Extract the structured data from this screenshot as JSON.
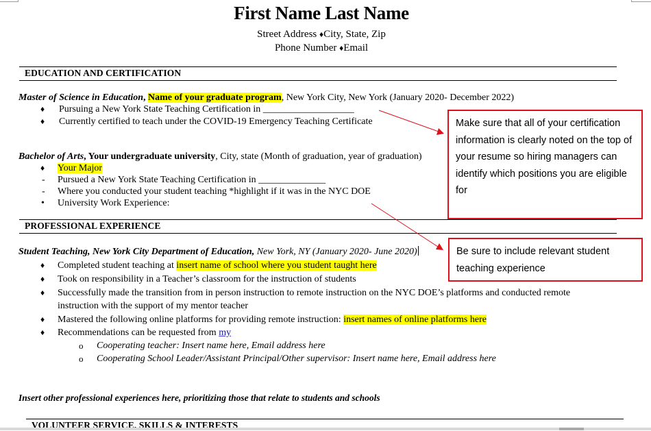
{
  "header": {
    "name": "First Name Last Name",
    "contact_line1": {
      "street": "Street Address ",
      "separator": "♦",
      "city": "City, State, Zip"
    },
    "contact_line2": {
      "phone": "Phone Number ",
      "separator": "♦",
      "email": "Email"
    }
  },
  "sections": {
    "education": {
      "title": "EDUCATION AND CERTIFICATION",
      "masters": {
        "degree": "Master of Science in Education",
        "comma": ", ",
        "program": "Name of your graduate program",
        "rest": ", New York City, New York (January 2020- December 2022)",
        "bullets": [
          {
            "marker": "♦",
            "text": "Pursuing a New York State Teaching Certification in ___________________"
          },
          {
            "marker": "♦",
            "text": "Currently certified to teach under the COVID-19 Emergency Teaching Certificate"
          }
        ]
      },
      "bachelors": {
        "degree": "Bachelor of Arts",
        "comma": ", ",
        "university": "Your undergraduate university",
        "rest": ", City, state (Month of graduation, year of graduation)",
        "bullets": [
          {
            "marker": "♦",
            "text": "Your Major",
            "highlight": true
          },
          {
            "marker": "-",
            "text": "Pursued a New York State Teaching Certification in ______________"
          },
          {
            "marker": "-",
            "text": "Where you conducted your student teaching *highlight if it was in the NYC DOE"
          },
          {
            "marker": "•",
            "text": "University Work Experience:"
          }
        ]
      }
    },
    "experience": {
      "title": "PROFESSIONAL EXPERIENCE",
      "student_teaching": {
        "role": "Student Teaching, New York City Department of Education,",
        "location_dates": " New York, NY (January 2020- June 2020)",
        "bullets": [
          {
            "marker": "♦",
            "prefix": "Completed student teaching at ",
            "highlight": "insert name of school where you student taught here"
          },
          {
            "marker": "♦",
            "prefix": "Took on responsibility in a Teacher’s classroom for the instruction of students"
          },
          {
            "marker": "♦",
            "prefix": "Successfully made the transition from in person instruction to remote instruction on the NYC DOE’s platforms and conducted remote",
            "continuation": "instruction with the support of my mentor teacher"
          },
          {
            "marker": "♦",
            "prefix": "Mastered the following online platforms for providing remote instruction: ",
            "highlight": "insert names of online platforms here"
          },
          {
            "marker": "♦",
            "prefix": "Recommendations can be requested from ",
            "link": "my"
          }
        ],
        "sub_bullets": [
          {
            "marker": "o",
            "text": "Cooperating teacher: Insert name here, Email address here"
          },
          {
            "marker": "o",
            "text": "Cooperating School Leader/Assistant Principal/Other supervisor: Insert name here, Email address here"
          }
        ]
      },
      "other_note": "Insert other professional experiences here, prioritizing those that relate to students and schools"
    },
    "volunteer": {
      "title": "VOLUNTEER SERVICE, SKILLS & INTERESTS"
    }
  },
  "annotations": [
    {
      "text": "Make sure that all of your certification information is clearly noted on the top of your resume so hiring managers can identify which positions you are eligible for"
    },
    {
      "text": "Be sure to include relevant student teaching experience"
    }
  ],
  "colors": {
    "highlight": "#ffff00",
    "annotation_border": "#e0101a",
    "arrow": "#e0101a"
  }
}
